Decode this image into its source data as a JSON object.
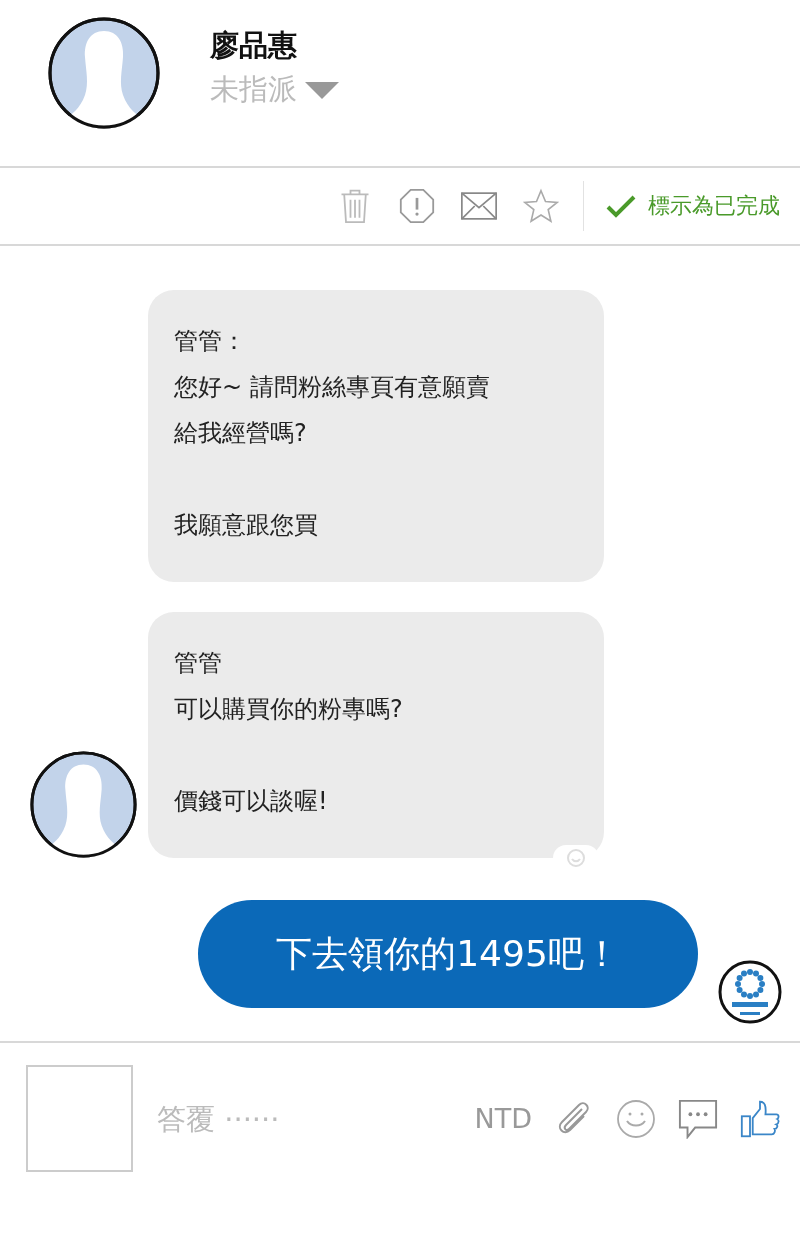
{
  "contact": {
    "name": "廖品惠",
    "assignee": "未指派"
  },
  "toolbar": {
    "done_label": "標示為已完成"
  },
  "messages": [
    {
      "kind": "incoming",
      "paragraphs": [
        [
          "管管：",
          "您好~ 請問粉絲專頁有意願賣",
          "給我經營嗎?"
        ],
        [
          "我願意跟您買"
        ]
      ],
      "show_avatar": false,
      "reaction": false
    },
    {
      "kind": "incoming",
      "paragraphs": [
        [
          "管管",
          "可以購買你的粉專嗎?"
        ],
        [
          "價錢可以談喔!"
        ]
      ],
      "show_avatar": true,
      "reaction": true
    },
    {
      "kind": "outgoing",
      "paragraphs": [
        [
          "下去領你的1495吧！"
        ]
      ],
      "show_avatar": true,
      "reaction": false
    }
  ],
  "composer": {
    "placeholder": "答覆 ······",
    "currency": "NTD"
  }
}
